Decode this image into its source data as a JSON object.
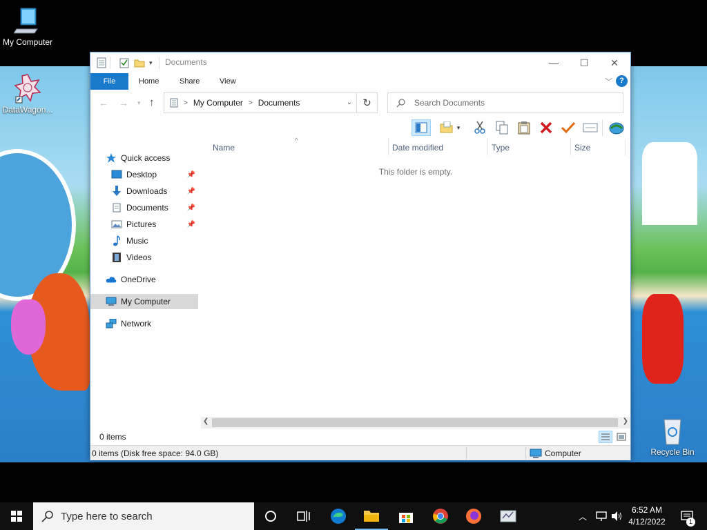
{
  "desktop": {
    "icons": [
      {
        "label": "My Computer",
        "icon": "computer-icon"
      },
      {
        "label": "DataWagon...",
        "icon": "datawagon-icon"
      },
      {
        "label": "Recycle Bin",
        "icon": "recycle-bin-icon"
      }
    ]
  },
  "window": {
    "title": "Documents",
    "controls": {
      "minimize": "—",
      "maximize": "☐",
      "close": "✕"
    },
    "ribbon": {
      "tabs": [
        {
          "label": "File",
          "active": true
        },
        {
          "label": "Home"
        },
        {
          "label": "Share"
        },
        {
          "label": "View"
        }
      ],
      "help": "?"
    },
    "address": {
      "segments": [
        "My Computer",
        "Documents"
      ]
    },
    "search": {
      "placeholder": "Search Documents"
    },
    "columns": [
      "Name",
      "Date modified",
      "Type",
      "Size"
    ],
    "nav_pane": {
      "items": [
        {
          "label": "Quick access",
          "icon": "star-icon"
        },
        {
          "label": "Desktop",
          "icon": "desktop-folder-icon",
          "pinned": true
        },
        {
          "label": "Downloads",
          "icon": "download-arrow-icon",
          "pinned": true
        },
        {
          "label": "Documents",
          "icon": "document-icon",
          "pinned": true
        },
        {
          "label": "Pictures",
          "icon": "picture-icon",
          "pinned": true
        },
        {
          "label": "Music",
          "icon": "music-note-icon"
        },
        {
          "label": "Videos",
          "icon": "film-icon"
        },
        {
          "label": "OneDrive",
          "icon": "cloud-icon"
        },
        {
          "label": "My Computer",
          "icon": "computer-icon",
          "selected": true
        },
        {
          "label": "Network",
          "icon": "network-icon"
        }
      ]
    },
    "empty_message": "This folder is empty.",
    "item_count": "0 items",
    "status": {
      "left": "0 items (Disk free space: 94.0 GB)",
      "right": "Computer"
    }
  },
  "taskbar": {
    "search_placeholder": "Type here to search",
    "apps": [
      "cortana-icon",
      "task-view-icon",
      "edge-icon",
      "file-explorer-icon",
      "store-icon",
      "chrome-icon",
      "firefox-icon",
      "app-icon"
    ],
    "clock": {
      "time": "6:52 AM",
      "date": "4/12/2022"
    },
    "notification_count": "1"
  },
  "colors": {
    "accent": "#1979ca",
    "selection": "#d9d9d9",
    "taskbar": "#101010"
  }
}
